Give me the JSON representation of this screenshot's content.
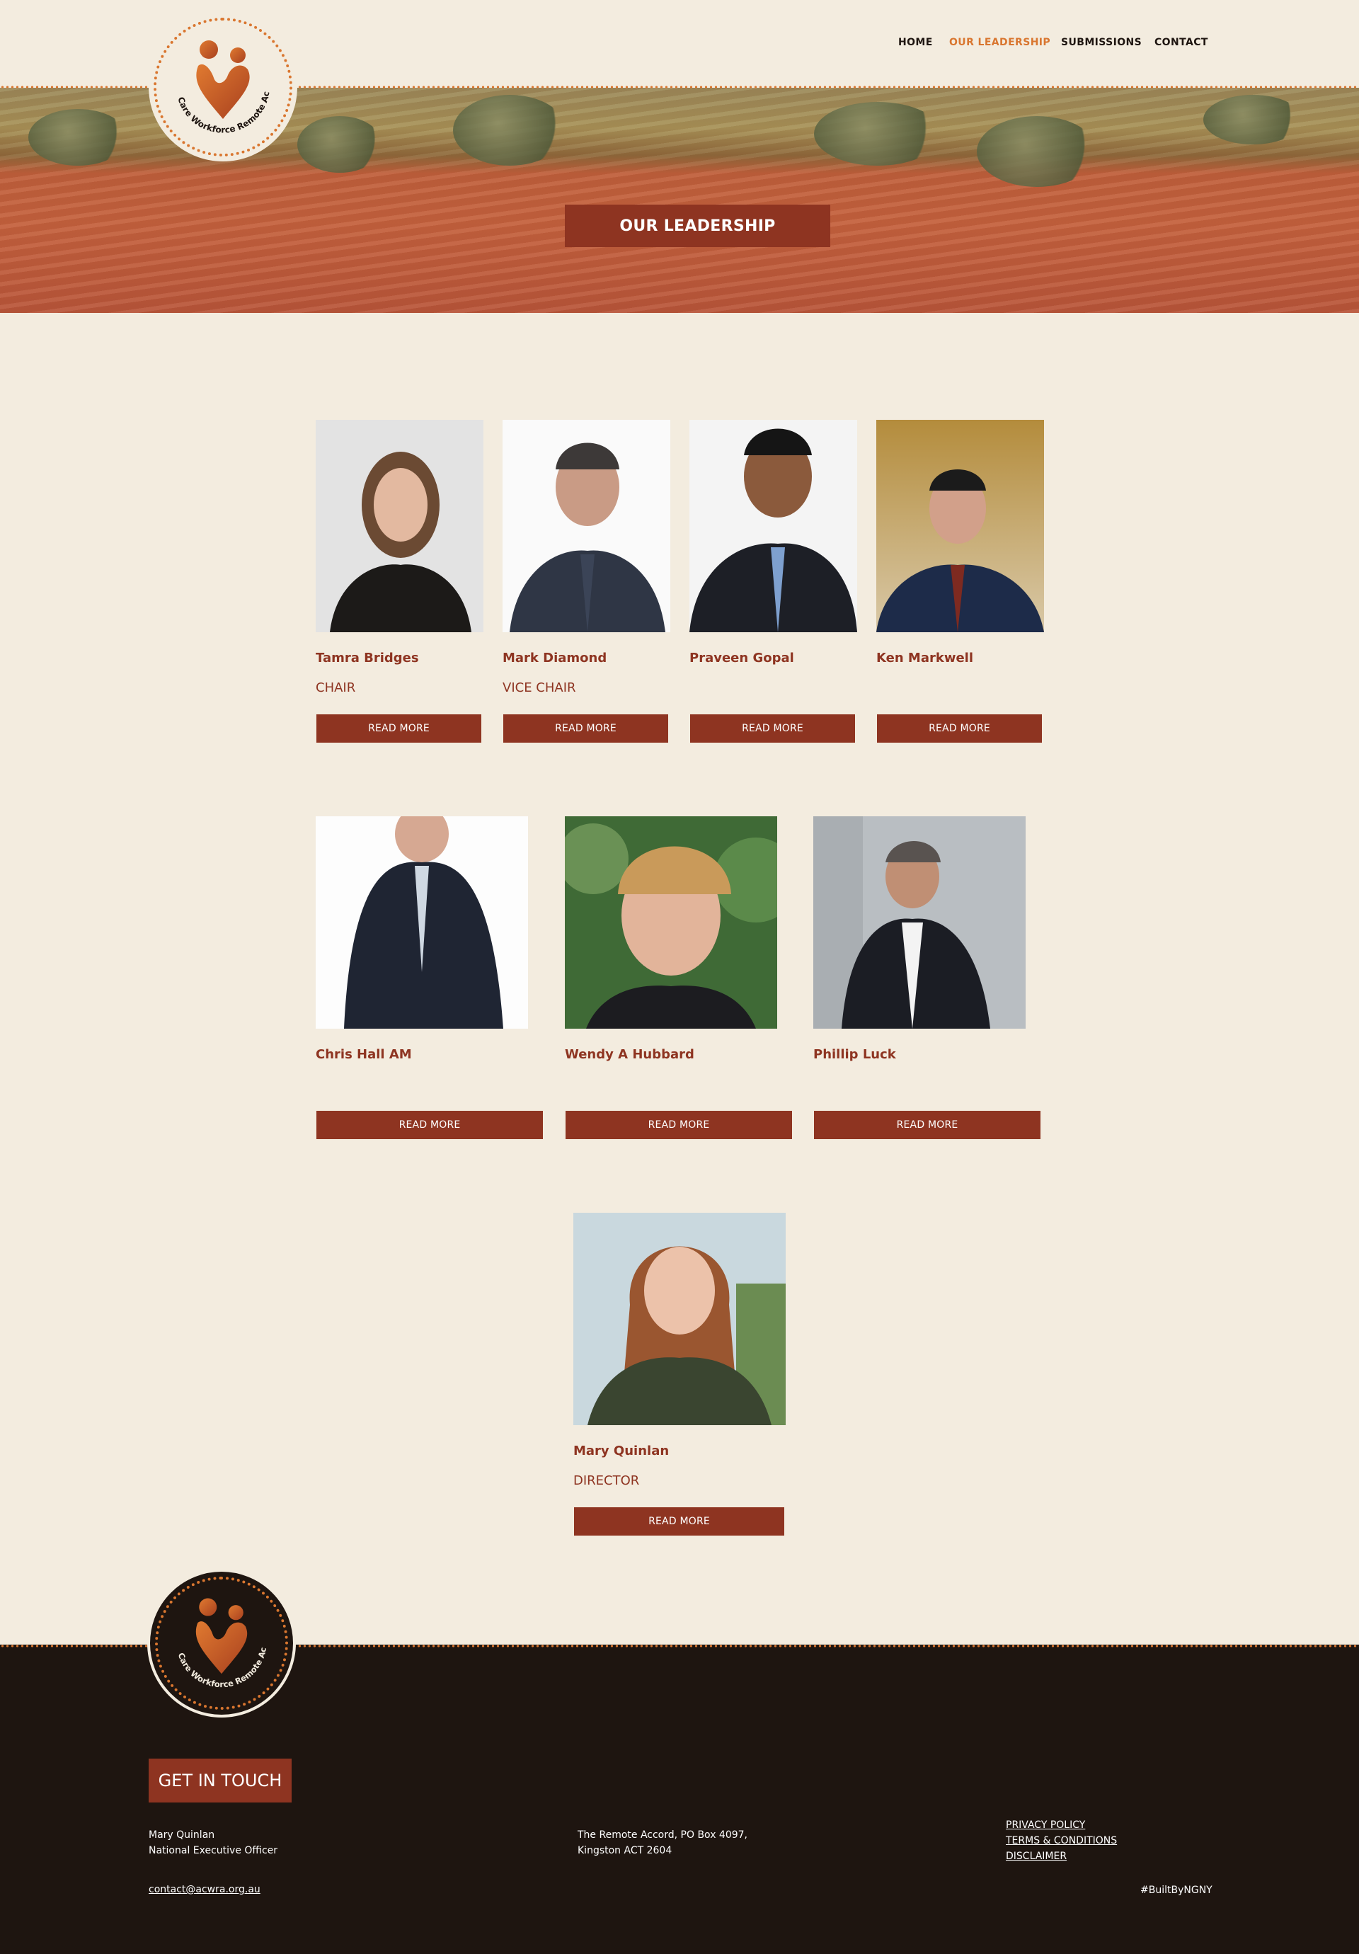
{
  "brand": {
    "logo_text": "Aged Care Workforce Remote Accord",
    "colors": {
      "accent": "#d9762f",
      "primary": "#8e3421",
      "background": "#f3ecdf",
      "footer": "#1e1510"
    }
  },
  "nav": {
    "items": [
      {
        "label": "HOME"
      },
      {
        "label": "OUR LEADERSHIP",
        "active": true
      },
      {
        "label": "SUBMISSIONS"
      },
      {
        "label": "CONTACT"
      }
    ]
  },
  "hero": {
    "title": "OUR LEADERSHIP"
  },
  "leaders": [
    {
      "name": "Tamra Bridges",
      "role": "CHAIR",
      "button": "READ MORE"
    },
    {
      "name": "Mark Diamond",
      "role": "VICE CHAIR",
      "button": "READ MORE"
    },
    {
      "name": "Praveen Gopal",
      "role": "",
      "button": "READ MORE"
    },
    {
      "name": "Ken Markwell",
      "role": "",
      "button": "READ MORE"
    },
    {
      "name": "Chris Hall AM",
      "role": "",
      "button": "READ MORE"
    },
    {
      "name": "Wendy A Hubbard",
      "role": "",
      "button": "READ MORE"
    },
    {
      "name": "Phillip Luck",
      "role": "",
      "button": "READ MORE"
    },
    {
      "name": "Mary Quinlan",
      "role": "DIRECTOR",
      "button": "READ MORE"
    }
  ],
  "footer": {
    "heading": "GET IN TOUCH",
    "contact_name": "Mary Quinlan",
    "contact_title": "National Executive Officer",
    "email": "contact@acwra.org.au",
    "address_line1": "The Remote Accord, PO Box 4097,",
    "address_line2": "Kingston ACT 2604",
    "links": [
      "PRIVACY POLICY",
      "TERMS & CONDITIONS",
      "DISCLAIMER"
    ],
    "credit": "#BuiltByNGNY"
  }
}
